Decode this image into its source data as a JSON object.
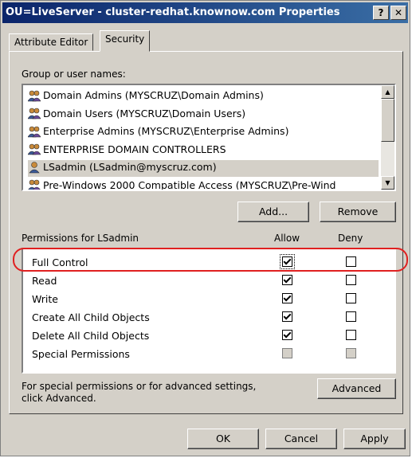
{
  "window": {
    "title": "OU=LiveServer - cluster-redhat.knownow.com Properties",
    "help_label": "?",
    "close_label": "✕"
  },
  "tabs": [
    {
      "label": "Attribute Editor",
      "active": false
    },
    {
      "label": "Security",
      "active": true
    }
  ],
  "groups": {
    "label": "Group or user names:",
    "items": [
      {
        "label": "Domain Admins (MYSCRUZ\\Domain Admins)",
        "icon": "group-icon",
        "selected": false
      },
      {
        "label": "Domain Users (MYSCRUZ\\Domain Users)",
        "icon": "group-icon",
        "selected": false
      },
      {
        "label": "Enterprise Admins (MYSCRUZ\\Enterprise Admins)",
        "icon": "group-icon",
        "selected": false
      },
      {
        "label": "ENTERPRISE DOMAIN CONTROLLERS",
        "icon": "group-icon",
        "selected": false
      },
      {
        "label": "LSadmin (LSadmin@myscruz.com)",
        "icon": "user-icon",
        "selected": true
      },
      {
        "label": "Pre-Windows 2000 Compatible Access (MYSCRUZ\\Pre-Wind",
        "icon": "group-icon",
        "selected": false
      }
    ],
    "add_label": "Add...",
    "remove_label": "Remove"
  },
  "permissions": {
    "label": "Permissions for LSadmin",
    "allow_header": "Allow",
    "deny_header": "Deny",
    "rows": [
      {
        "name": "Full Control",
        "allow": true,
        "deny": false,
        "focused": true,
        "disabled": false
      },
      {
        "name": "Read",
        "allow": true,
        "deny": false,
        "focused": false,
        "disabled": false
      },
      {
        "name": "Write",
        "allow": true,
        "deny": false,
        "focused": false,
        "disabled": false
      },
      {
        "name": "Create All Child Objects",
        "allow": true,
        "deny": false,
        "focused": false,
        "disabled": false
      },
      {
        "name": "Delete All Child Objects",
        "allow": true,
        "deny": false,
        "focused": false,
        "disabled": false
      },
      {
        "name": "Special Permissions",
        "allow": false,
        "deny": false,
        "focused": false,
        "disabled": true
      }
    ]
  },
  "advanced": {
    "text": "For special permissions or for advanced settings, click Advanced.",
    "button_label": "Advanced"
  },
  "footer": {
    "ok_label": "OK",
    "cancel_label": "Cancel",
    "apply_label": "Apply"
  },
  "colors": {
    "highlight": "#e02020",
    "title_bar": "#0a246a"
  }
}
